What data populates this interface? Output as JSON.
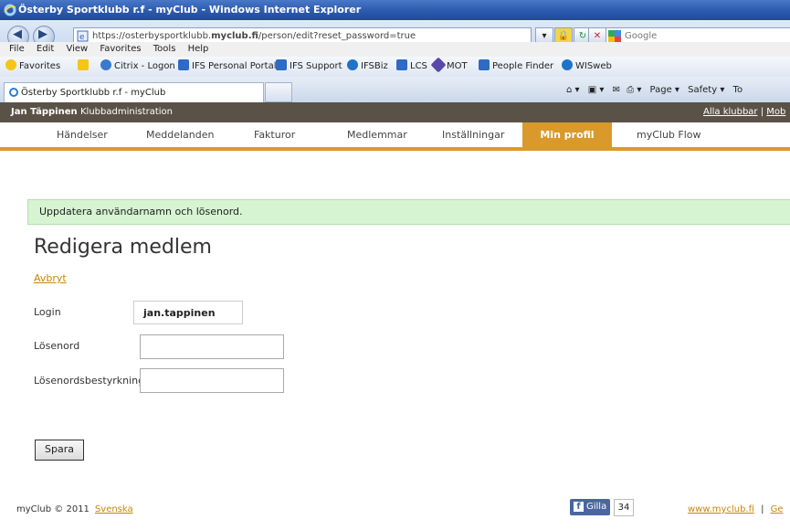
{
  "window": {
    "title": "Österby Sportklubb r.f - myClub - Windows Internet Explorer"
  },
  "browser": {
    "url_prefix": "https://osterbysportklubb.",
    "url_domain": "myclub.fi",
    "url_path": "/person/edit?reset_password=true",
    "search_placeholder": "Google",
    "menu": [
      "File",
      "Edit",
      "View",
      "Favorites",
      "Tools",
      "Help"
    ],
    "favorites_label": "Favorites",
    "favorites": [
      {
        "label": "Citrix - Logon",
        "color": "#3a7ad0"
      },
      {
        "label": "IFS Personal Portal",
        "color": "#2f6ac4"
      },
      {
        "label": "IFS Support",
        "color": "#2f6ac4"
      },
      {
        "label": "IFSBiz",
        "color": "#1e72c8"
      },
      {
        "label": "LCS",
        "color": "#2f6ac4"
      },
      {
        "label": "MOT",
        "color": "#5a48a8"
      },
      {
        "label": "People Finder",
        "color": "#2f6ac4"
      },
      {
        "label": "WISweb",
        "color": "#1e72c8"
      }
    ],
    "tab_title": "Österby Sportklubb r.f - myClub",
    "command_bar": [
      "Page ▾",
      "Safety ▾",
      "To"
    ]
  },
  "site": {
    "user_name": "Jan Täppinen",
    "admin_link": "Klubbadministration",
    "all_clubs": "Alla klubbar",
    "mobile": "Mob",
    "accent": "#d99a2b",
    "nav": [
      "Händelser",
      "Meddelanden",
      "Fakturor",
      "Medlemmar",
      "Inställningar",
      "Min profil",
      "myClub Flow"
    ],
    "active_nav": "Min profil"
  },
  "page": {
    "notice": "Uppdatera användarnamn och lösenord.",
    "heading": "Redigera medlem",
    "cancel_link": "Avbryt",
    "login_label": "Login",
    "login_value": "jan.tappinen",
    "password_label": "Lösenord",
    "password_value": "",
    "confirm_label": "Lösenordsbestyrkning",
    "confirm_value": "",
    "save_button": "Spara"
  },
  "footer": {
    "copyright": "myClub © 2011",
    "language": "Svenska",
    "like_label": "Gilla",
    "like_count": "34",
    "site_link": "www.myclub.fi",
    "separator": "|",
    "trailing_link": "Ge"
  }
}
